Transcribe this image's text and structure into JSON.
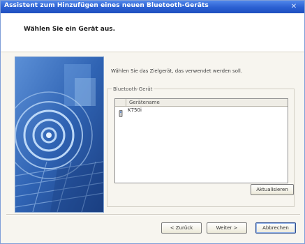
{
  "window": {
    "title": "Assistent zum Hinzufügen eines neuen Bluetooth-Geräts",
    "close_glyph": "✕"
  },
  "header": {
    "title": "Wählen Sie ein Gerät aus."
  },
  "main": {
    "description": "Wählen Sie das Zielgerät, das verwendet werden soll.",
    "group_label": "Bluetooth-Gerät",
    "list": {
      "columns": [
        "Gerätename"
      ],
      "rows": [
        {
          "icon": "bluetooth-device-icon",
          "name": "K750i"
        }
      ]
    },
    "refresh_label": "Aktualisieren"
  },
  "footer": {
    "back_label": "< Zurück",
    "next_label": "Weiter >",
    "cancel_label": "Abbrechen"
  },
  "colors": {
    "titlebar": "#2a5fd1",
    "dialog_background": "#f7f5ef",
    "art_blue": "#2f63b3"
  }
}
